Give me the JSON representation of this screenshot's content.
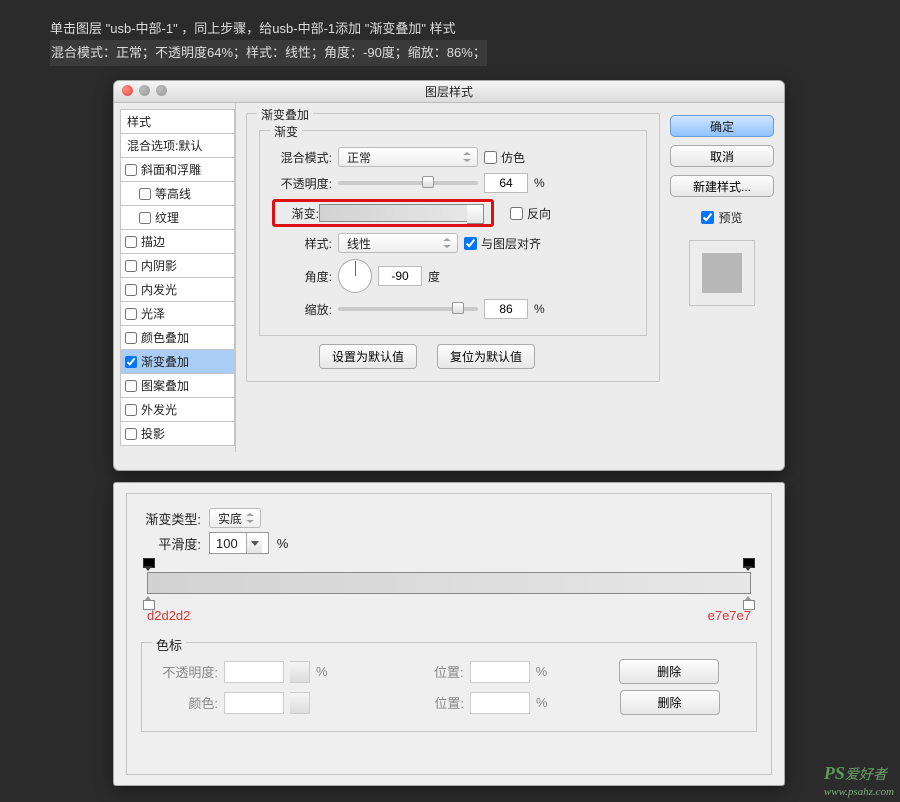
{
  "instructions": {
    "line1_a": "单击图层 \"usb-中部-1\" ，同上步骤，给usb-中部-1添加",
    "line1_b": "\"渐变叠加\"",
    "line1_c": "样式",
    "line2": "混合模式：正常；不透明度64%；样式：线性；角度：-90度；缩放：86%；"
  },
  "dialog": {
    "title": "图层样式",
    "styles_header": "样式",
    "blend_options": "混合选项:默认",
    "style_items": [
      {
        "label": "斜面和浮雕",
        "checked": false,
        "indent": false
      },
      {
        "label": "等高线",
        "checked": false,
        "indent": true
      },
      {
        "label": "纹理",
        "checked": false,
        "indent": true
      },
      {
        "label": "描边",
        "checked": false,
        "indent": false
      },
      {
        "label": "内阴影",
        "checked": false,
        "indent": false
      },
      {
        "label": "内发光",
        "checked": false,
        "indent": false
      },
      {
        "label": "光泽",
        "checked": false,
        "indent": false
      },
      {
        "label": "颜色叠加",
        "checked": false,
        "indent": false
      },
      {
        "label": "渐变叠加",
        "checked": true,
        "indent": false,
        "active": true
      },
      {
        "label": "图案叠加",
        "checked": false,
        "indent": false
      },
      {
        "label": "外发光",
        "checked": false,
        "indent": false
      },
      {
        "label": "投影",
        "checked": false,
        "indent": false
      }
    ],
    "section_title": "渐变叠加",
    "inner_title": "渐变",
    "labels": {
      "blend_mode": "混合模式:",
      "opacity": "不透明度:",
      "gradient": "渐变:",
      "style": "样式:",
      "angle": "角度:",
      "scale": "缩放:",
      "dither": "仿色",
      "reverse": "反向",
      "align": "与图层对齐",
      "degree": "度",
      "percent": "%",
      "set_default": "设置为默认值",
      "reset_default": "复位为默认值"
    },
    "values": {
      "blend_mode": "正常",
      "opacity": "64",
      "style": "线性",
      "angle": "-90",
      "scale": "86",
      "dither": false,
      "reverse": false,
      "align": true
    },
    "buttons": {
      "ok": "确定",
      "cancel": "取消",
      "new_style": "新建样式...",
      "preview": "预览"
    }
  },
  "editor": {
    "type_label": "渐变类型:",
    "type_value": "实底",
    "smooth_label": "平滑度:",
    "smooth_value": "100",
    "percent": "%",
    "color_left": "d2d2d2",
    "color_right": "e7e7e7",
    "stops_title": "色标",
    "opacity_label": "不透明度:",
    "position_label": "位置:",
    "color_label": "颜色:",
    "delete": "删除"
  },
  "watermark": {
    "brand": "PS",
    "text": "爱好者",
    "url": "www.psahz.com"
  }
}
